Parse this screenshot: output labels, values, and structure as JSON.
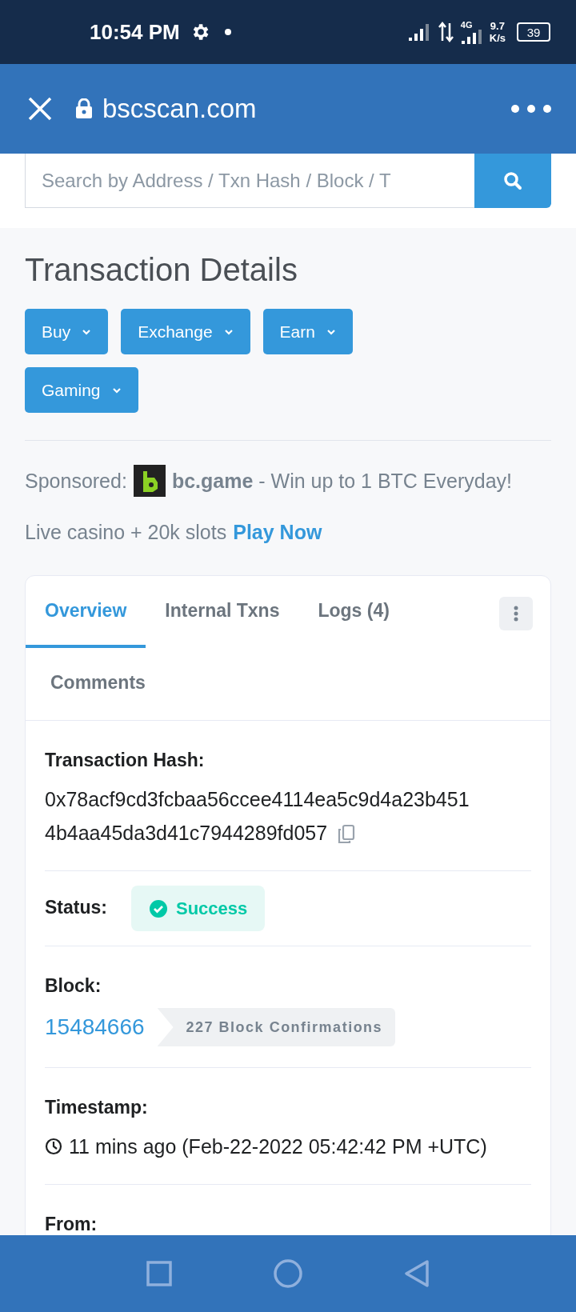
{
  "status_bar": {
    "time": "10:54 PM",
    "network_type": "4G",
    "speed": "9.7",
    "speed_unit": "K/s",
    "battery": "39"
  },
  "browser": {
    "url": "bscscan.com"
  },
  "search": {
    "placeholder": "Search by Address / Txn Hash / Block / T"
  },
  "page_title": "Transaction Details",
  "menu_buttons": [
    {
      "label": "Buy"
    },
    {
      "label": "Exchange"
    },
    {
      "label": "Earn"
    },
    {
      "label": "Gaming"
    }
  ],
  "sponsored": {
    "label": "Sponsored:",
    "text": "**bc.game** - Win up to 1 BTC Everyday!",
    "text_2": "Live casino + 20k slots",
    "link": "Play Now"
  },
  "tabs": [
    {
      "label": "Overview",
      "selected": true
    },
    {
      "label": "Internal Txns",
      "selected": false
    },
    {
      "label": "Logs (4)",
      "selected": false
    },
    {
      "label": "Comments",
      "selected": false
    }
  ],
  "details": [
    {
      "kind": "hash",
      "label": "Transaction Hash:",
      "value_lines": [
        "0x78acf9cd3fcbaa56ccee4114ea5c9d4a23b451",
        "4b4aa45da3d41c7944289fd057"
      ]
    },
    {
      "kind": "status",
      "label": "Status:",
      "value": "Success"
    },
    {
      "kind": "block",
      "label": "Block:",
      "value": "15484666",
      "confirmations": "227 Block Confirmations"
    },
    {
      "kind": "timestamp",
      "label": "Timestamp:",
      "value": "11 mins ago (Feb-22-2022 05:42:42 PM +UTC)"
    },
    {
      "kind": "label_only",
      "label": "From:"
    }
  ]
}
